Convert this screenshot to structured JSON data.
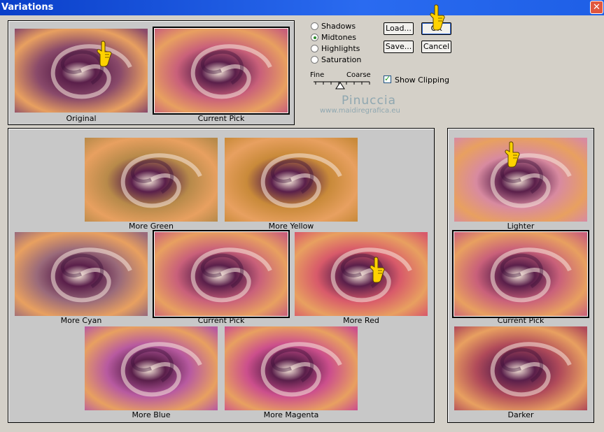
{
  "window": {
    "title": "Variations",
    "close_glyph": "✕"
  },
  "top_previews": [
    {
      "caption": "Original",
      "tint": "#8a4a6a"
    },
    {
      "caption": "Current Pick",
      "tint": "#c9607a"
    }
  ],
  "range_options": [
    {
      "label": "Shadows",
      "checked": false
    },
    {
      "label": "Midtones",
      "checked": true
    },
    {
      "label": "Highlights",
      "checked": false
    },
    {
      "label": "Saturation",
      "checked": false
    }
  ],
  "buttons": {
    "load": "Load...",
    "ok": "OK",
    "save": "Save...",
    "cancel": "Cancel"
  },
  "slider": {
    "fine": "Fine",
    "coarse": "Coarse"
  },
  "show_clipping": {
    "label": "Show Clipping",
    "checked": true
  },
  "watermark": {
    "name": "Pinuccia",
    "url": "www.maidiregrafica.eu"
  },
  "color_variations": [
    {
      "caption": "More Green",
      "tint": "#b88a4a"
    },
    {
      "caption": "More Yellow",
      "tint": "#c98a3a"
    },
    {
      "caption": "More Cyan",
      "tint": "#9a6a7a"
    },
    {
      "caption": "Current Pick",
      "tint": "#c9607a"
    },
    {
      "caption": "More Red",
      "tint": "#d85a6a"
    },
    {
      "caption": "More Blue",
      "tint": "#b85aa0"
    },
    {
      "caption": "More Magenta",
      "tint": "#cc4f8c"
    }
  ],
  "brightness_variations": [
    {
      "caption": "Lighter",
      "tint": "#d88aa0"
    },
    {
      "caption": "Current Pick",
      "tint": "#c9607a"
    },
    {
      "caption": "Darker",
      "tint": "#b04a5a"
    }
  ]
}
